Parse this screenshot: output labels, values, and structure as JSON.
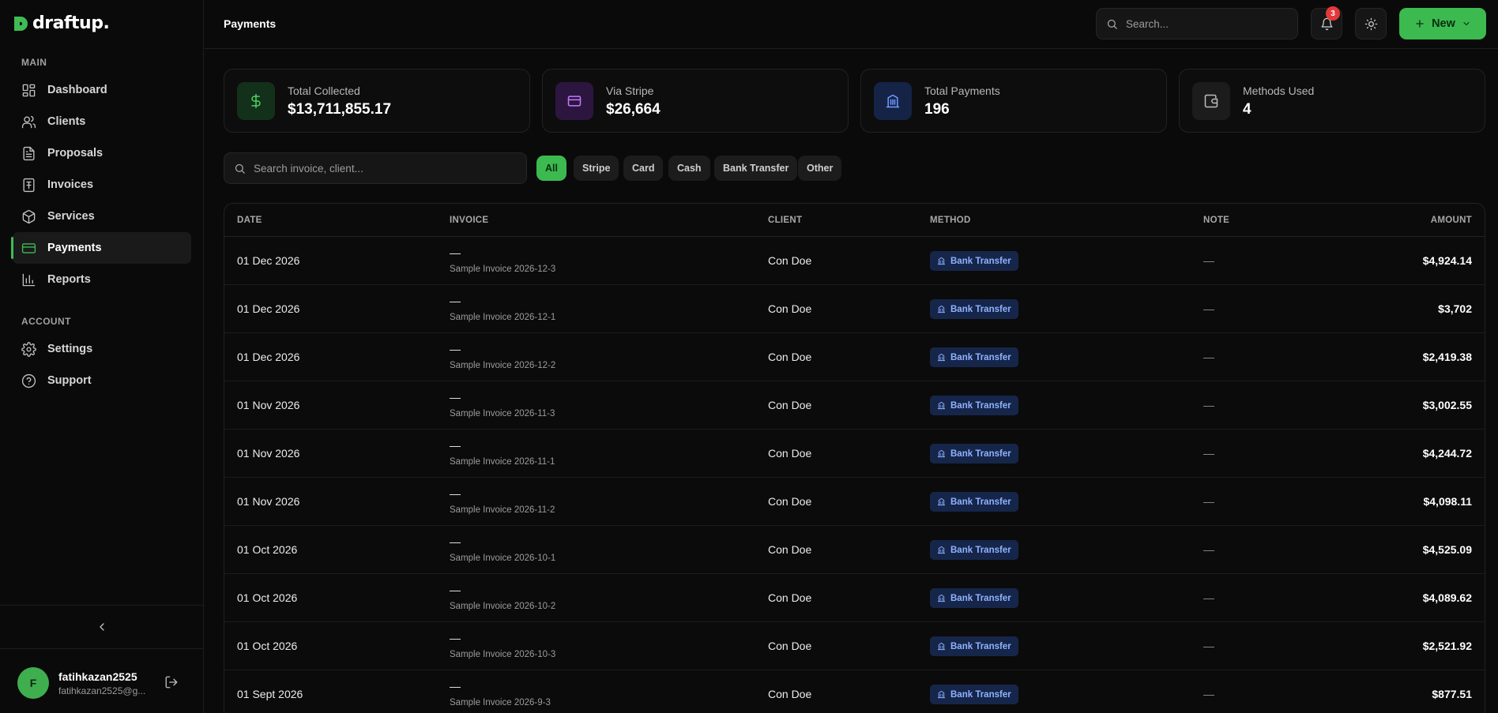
{
  "brand": {
    "name": "draftup.",
    "accent": "#3cba50"
  },
  "sidebar": {
    "sections": {
      "main": "MAIN",
      "account": "ACCOUNT"
    },
    "items": [
      {
        "label": "Dashboard",
        "icon": "dashboard-icon"
      },
      {
        "label": "Clients",
        "icon": "users-icon"
      },
      {
        "label": "Proposals",
        "icon": "document-icon"
      },
      {
        "label": "Invoices",
        "icon": "invoice-icon"
      },
      {
        "label": "Services",
        "icon": "box-icon"
      },
      {
        "label": "Payments",
        "icon": "credit-card-icon",
        "active": true
      },
      {
        "label": "Reports",
        "icon": "bar-chart-icon"
      }
    ],
    "account_items": [
      {
        "label": "Settings",
        "icon": "gear-icon"
      },
      {
        "label": "Support",
        "icon": "help-icon"
      }
    ],
    "user": {
      "initial": "F",
      "name": "fatihkazan2525",
      "email": "fatihkazan2525@g..."
    }
  },
  "header": {
    "title": "Payments",
    "search_placeholder": "Search...",
    "notifications_count": "3",
    "new_label": "New"
  },
  "stats": [
    {
      "label": "Total Collected",
      "value": "$13,711,855.17",
      "icon": "dollar-icon"
    },
    {
      "label": "Via Stripe",
      "value": "$26,664",
      "icon": "card-icon"
    },
    {
      "label": "Total Payments",
      "value": "196",
      "icon": "building-icon"
    },
    {
      "label": "Methods Used",
      "value": "4",
      "icon": "wallet-icon"
    }
  ],
  "filters": {
    "search_placeholder": "Search invoice, client...",
    "chips": [
      "All",
      "Stripe",
      "Card",
      "Cash",
      "Bank Transfer",
      "Other"
    ],
    "active": "All"
  },
  "table": {
    "headers": {
      "date": "DATE",
      "invoice": "INVOICE",
      "client": "CLIENT",
      "method": "METHOD",
      "note": "NOTE",
      "amount": "AMOUNT"
    },
    "rows": [
      {
        "date": "01 Dec 2026",
        "invoice": "—",
        "invoice_sub": "Sample Invoice 2026-12-3",
        "client": "Con Doe",
        "method": "Bank Transfer",
        "note": "—",
        "amount": "$4,924.14"
      },
      {
        "date": "01 Dec 2026",
        "invoice": "—",
        "invoice_sub": "Sample Invoice 2026-12-1",
        "client": "Con Doe",
        "method": "Bank Transfer",
        "note": "—",
        "amount": "$3,702"
      },
      {
        "date": "01 Dec 2026",
        "invoice": "—",
        "invoice_sub": "Sample Invoice 2026-12-2",
        "client": "Con Doe",
        "method": "Bank Transfer",
        "note": "—",
        "amount": "$2,419.38"
      },
      {
        "date": "01 Nov 2026",
        "invoice": "—",
        "invoice_sub": "Sample Invoice 2026-11-3",
        "client": "Con Doe",
        "method": "Bank Transfer",
        "note": "—",
        "amount": "$3,002.55"
      },
      {
        "date": "01 Nov 2026",
        "invoice": "—",
        "invoice_sub": "Sample Invoice 2026-11-1",
        "client": "Con Doe",
        "method": "Bank Transfer",
        "note": "—",
        "amount": "$4,244.72"
      },
      {
        "date": "01 Nov 2026",
        "invoice": "—",
        "invoice_sub": "Sample Invoice 2026-11-2",
        "client": "Con Doe",
        "method": "Bank Transfer",
        "note": "—",
        "amount": "$4,098.11"
      },
      {
        "date": "01 Oct 2026",
        "invoice": "—",
        "invoice_sub": "Sample Invoice 2026-10-1",
        "client": "Con Doe",
        "method": "Bank Transfer",
        "note": "—",
        "amount": "$4,525.09"
      },
      {
        "date": "01 Oct 2026",
        "invoice": "—",
        "invoice_sub": "Sample Invoice 2026-10-2",
        "client": "Con Doe",
        "method": "Bank Transfer",
        "note": "—",
        "amount": "$4,089.62"
      },
      {
        "date": "01 Oct 2026",
        "invoice": "—",
        "invoice_sub": "Sample Invoice 2026-10-3",
        "client": "Con Doe",
        "method": "Bank Transfer",
        "note": "—",
        "amount": "$2,521.92"
      },
      {
        "date": "01 Sept 2026",
        "invoice": "—",
        "invoice_sub": "Sample Invoice 2026-9-3",
        "client": "Con Doe",
        "method": "Bank Transfer",
        "note": "—",
        "amount": "$877.51"
      }
    ]
  }
}
